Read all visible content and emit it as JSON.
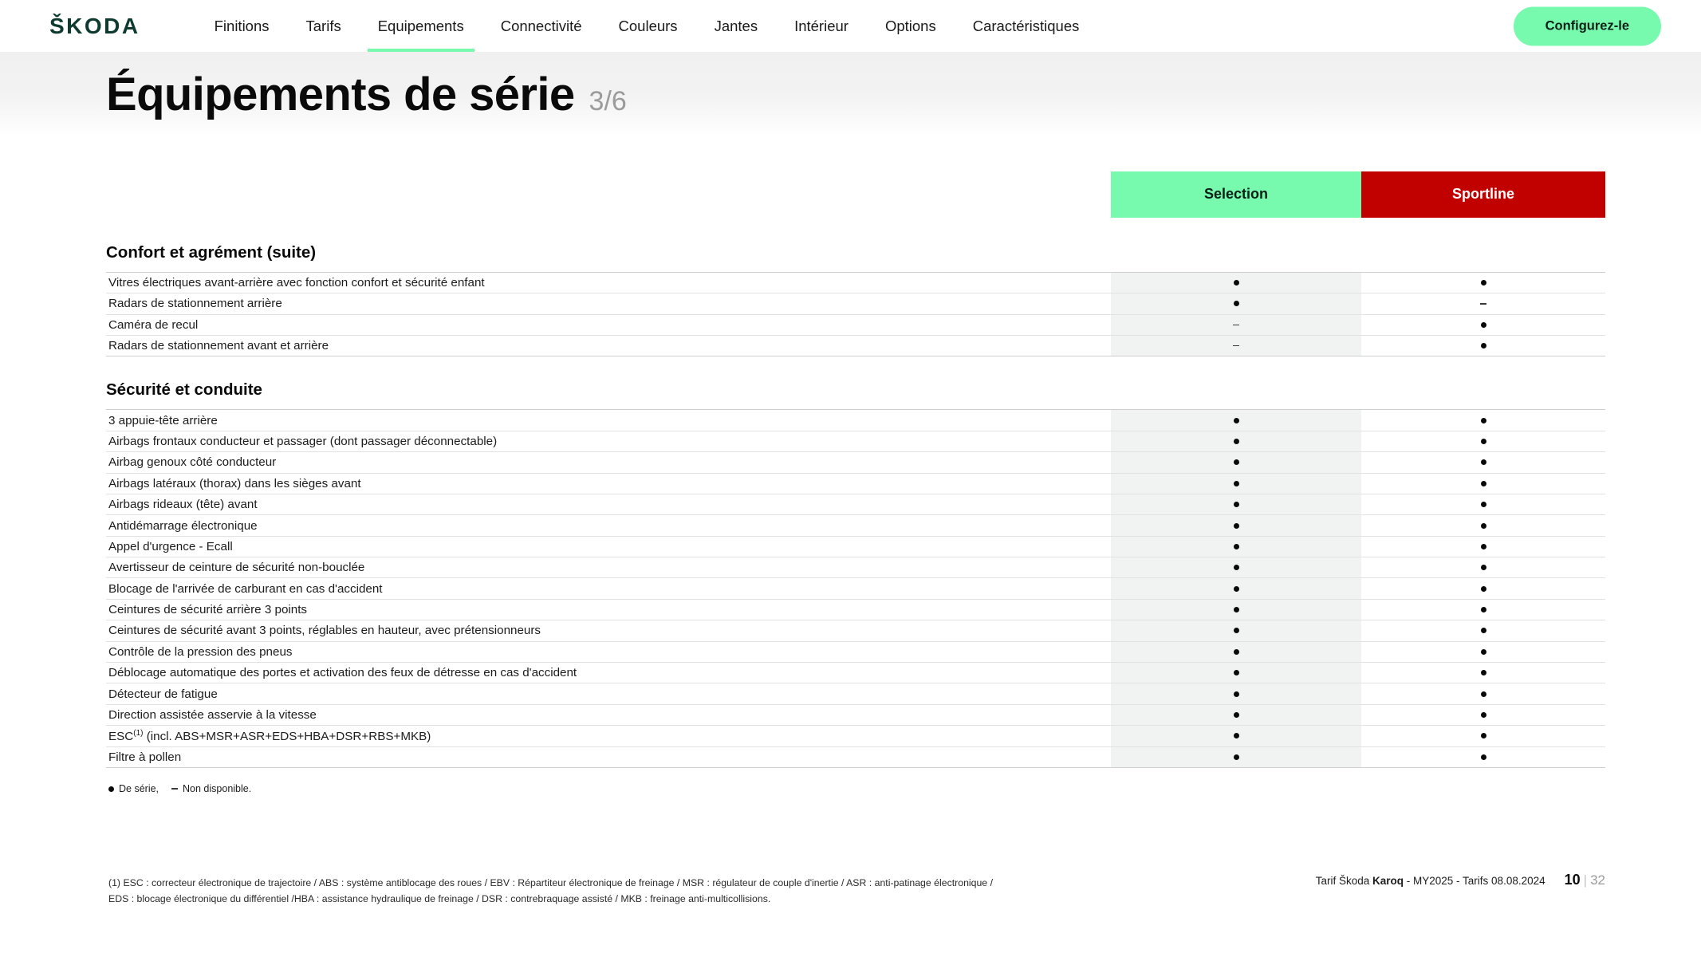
{
  "brand": {
    "logo_text": "ŠKODA",
    "logo_color": "#0e3a2f",
    "accent_green": "#78faae",
    "accent_red": "#c10000"
  },
  "nav": {
    "items": [
      {
        "label": "Finitions",
        "active": false
      },
      {
        "label": "Tarifs",
        "active": false
      },
      {
        "label": "Equipements",
        "active": true
      },
      {
        "label": "Connectivité",
        "active": false
      },
      {
        "label": "Couleurs",
        "active": false
      },
      {
        "label": "Jantes",
        "active": false
      },
      {
        "label": "Intérieur",
        "active": false
      },
      {
        "label": "Options",
        "active": false
      },
      {
        "label": "Caractéristiques",
        "active": false
      }
    ],
    "cta_label": "Configurez-le"
  },
  "header": {
    "title": "Équipements de série",
    "counter": "3/6"
  },
  "table": {
    "columns": [
      {
        "label": "Selection",
        "style": "green"
      },
      {
        "label": "Sportline",
        "style": "red"
      }
    ],
    "sections": [
      {
        "title": "Confort et agrément (suite)",
        "rows": [
          {
            "label": "Vitres électriques avant-arrière avec fonction confort et sécurité enfant",
            "values": [
              "dot",
              "dot"
            ]
          },
          {
            "label": "Radars de stationnement arrière",
            "values": [
              "dot",
              "dash"
            ]
          },
          {
            "label": "Caméra de recul",
            "values": [
              "dash",
              "dot"
            ]
          },
          {
            "label": "Radars de stationnement avant et arrière",
            "values": [
              "dash",
              "dot"
            ]
          }
        ]
      },
      {
        "title": "Sécurité et conduite",
        "rows": [
          {
            "label": "3 appuie-tête arrière",
            "values": [
              "dot",
              "dot"
            ]
          },
          {
            "label": "Airbags frontaux conducteur et passager (dont passager déconnectable)",
            "values": [
              "dot",
              "dot"
            ]
          },
          {
            "label": "Airbag genoux côté conducteur",
            "values": [
              "dot",
              "dot"
            ]
          },
          {
            "label": "Airbags latéraux (thorax) dans les sièges avant",
            "values": [
              "dot",
              "dot"
            ]
          },
          {
            "label": "Airbags rideaux (tête) avant",
            "values": [
              "dot",
              "dot"
            ]
          },
          {
            "label": "Antidémarrage électronique",
            "values": [
              "dot",
              "dot"
            ]
          },
          {
            "label": "Appel d'urgence - Ecall",
            "values": [
              "dot",
              "dot"
            ]
          },
          {
            "label": "Avertisseur de ceinture de sécurité non-bouclée",
            "values": [
              "dot",
              "dot"
            ]
          },
          {
            "label": "Blocage de l'arrivée de carburant en cas d'accident",
            "values": [
              "dot",
              "dot"
            ]
          },
          {
            "label": "Ceintures de sécurité arrière 3 points",
            "values": [
              "dot",
              "dot"
            ]
          },
          {
            "label": "Ceintures de sécurité avant 3 points, réglables en hauteur, avec prétensionneurs",
            "values": [
              "dot",
              "dot"
            ]
          },
          {
            "label": "Contrôle de la pression des pneus",
            "values": [
              "dot",
              "dot"
            ]
          },
          {
            "label": "Déblocage automatique des portes et activation des feux de détresse en cas d'accident",
            "values": [
              "dot",
              "dot"
            ]
          },
          {
            "label": "Détecteur de fatigue",
            "values": [
              "dot",
              "dot"
            ]
          },
          {
            "label": "Direction assistée asservie à la vitesse",
            "values": [
              "dot",
              "dot"
            ]
          },
          {
            "label": "ESC(1) (incl. ABS+MSR+ASR+EDS+HBA+DSR+RBS+MKB)",
            "label_main": "ESC",
            "label_sup": "(1)",
            "label_rest": " (incl. ABS+MSR+ASR+EDS+HBA+DSR+RBS+MKB)",
            "values": [
              "dot",
              "dot"
            ]
          },
          {
            "label": "Filtre à pollen",
            "values": [
              "dot",
              "dot"
            ]
          }
        ]
      }
    ]
  },
  "legend": {
    "serie": "De série,",
    "non_dispo": "Non disponible."
  },
  "footnotes": {
    "line1": "(1) ESC : correcteur électronique de trajectoire / ABS : système antiblocage des roues / EBV : Répartiteur électronique de freinage / MSR : régulateur de couple d'inertie / ASR : anti-patinage électronique /",
    "line2": "EDS : blocage électronique du différentiel /HBA : assistance hydraulique de freinage / DSR : contrebraquage assisté / MKB : freinage anti-multicollisions."
  },
  "footer": {
    "prefix": "Tarif Škoda ",
    "model": "Karoq",
    "suffix": " - MY2025 - Tarifs 08.08.2024",
    "page": "10",
    "separator": "|",
    "total": "32"
  }
}
